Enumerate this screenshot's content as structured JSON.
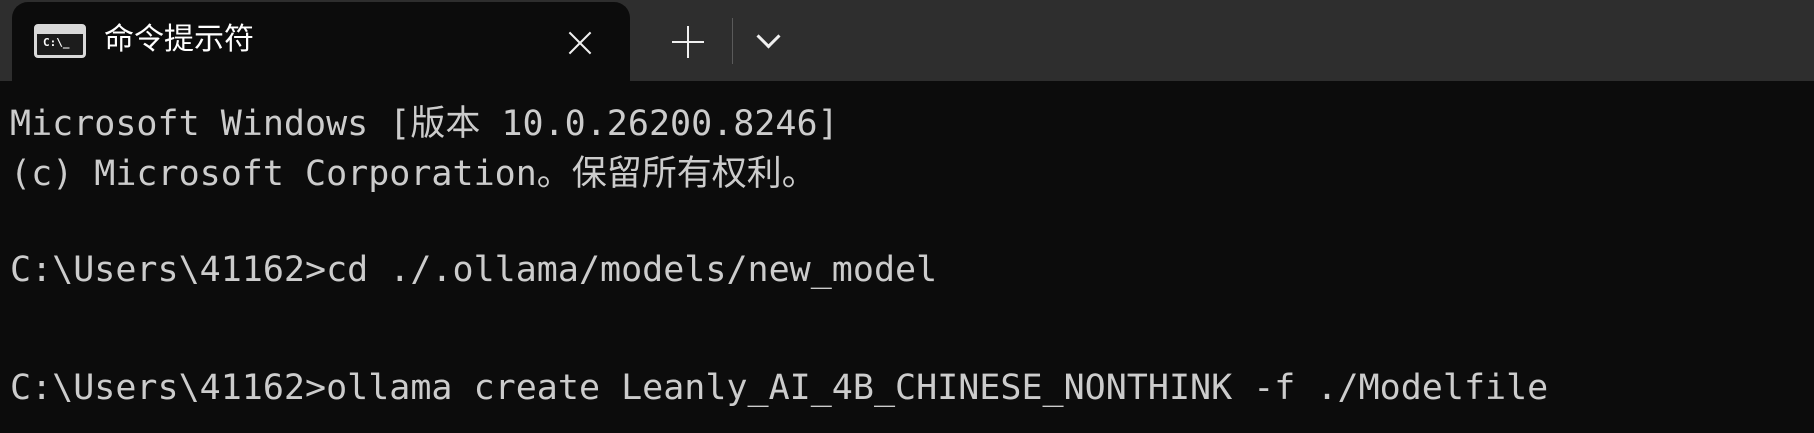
{
  "tab": {
    "title": "命令提示符",
    "icon": "cmd-icon",
    "icon_text": "C:\\_"
  },
  "controls": {
    "close_icon": "close-icon",
    "new_tab_icon": "plus-icon",
    "dropdown_icon": "chevron-down-icon"
  },
  "terminal": {
    "lines": [
      "Microsoft Windows [版本 10.0.26200.8246]",
      "(c) Microsoft Corporation。保留所有权利。",
      "C:\\Users\\41162>cd ./.ollama/models/new_model",
      "C:\\Users\\41162>ollama create Leanly_AI_4B_CHINESE_NONTHINK -f ./Modelfile"
    ]
  },
  "colors": {
    "titlebar": "#2e2e2e",
    "background": "#0c0c0c",
    "text": "#cccccc"
  }
}
